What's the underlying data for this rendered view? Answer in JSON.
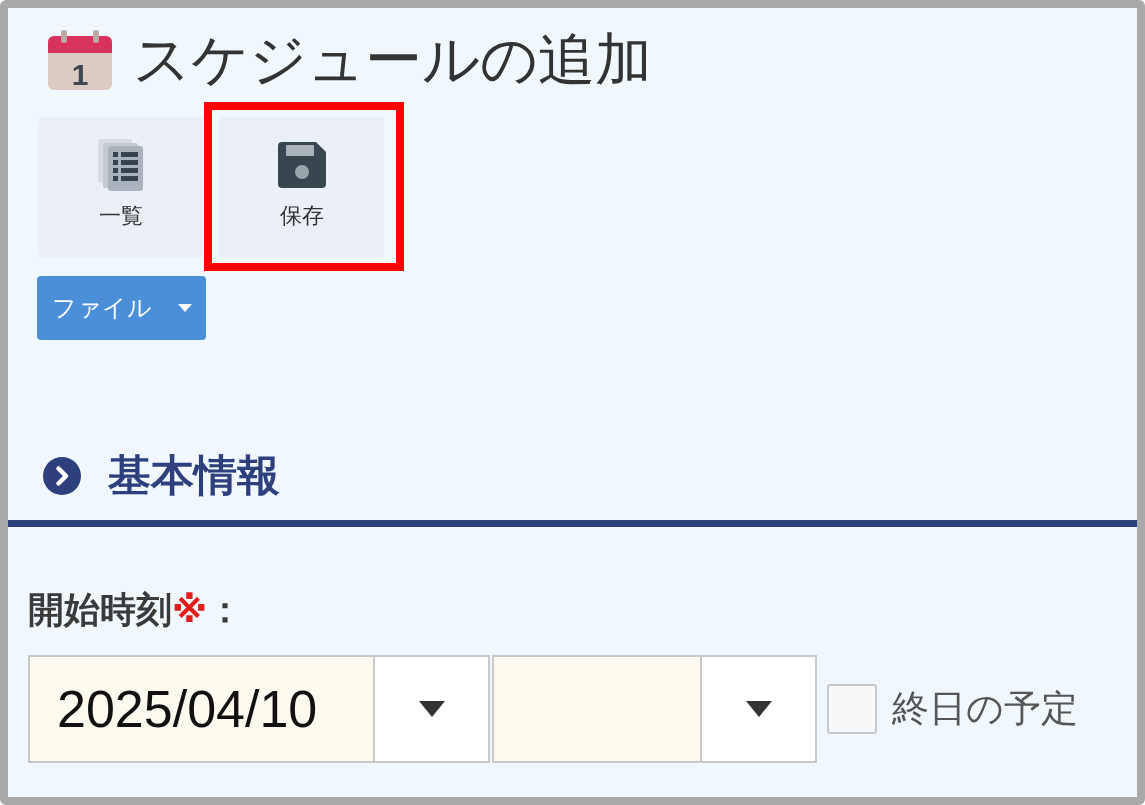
{
  "page": {
    "title": "スケジュールの追加",
    "calendar_day": "1"
  },
  "toolbar": {
    "buttons": [
      {
        "kind": "list",
        "label": "一覧",
        "highlighted": false
      },
      {
        "kind": "save",
        "label": "保存",
        "highlighted": true
      }
    ]
  },
  "file_menu": {
    "label": "ファイル"
  },
  "section": {
    "title": "基本情報"
  },
  "start_time": {
    "label": "開始時刻",
    "required_mark": "※",
    "suffix": "：",
    "fields": [
      {
        "kind": "date",
        "value": "2025/04/10"
      },
      {
        "kind": "time"
      }
    ],
    "all_day": {
      "label": "終日の予定",
      "checked": false
    }
  }
}
